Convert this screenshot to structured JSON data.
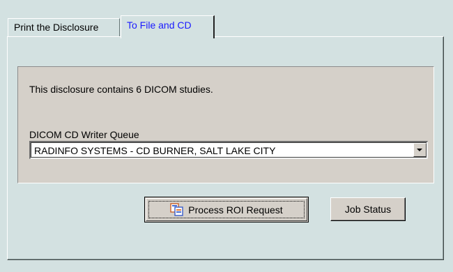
{
  "tabs": [
    {
      "label": "Print the Disclosure",
      "active": false
    },
    {
      "label": "To File and CD",
      "active": true
    }
  ],
  "panel": {
    "info_text": "This disclosure contains 6 DICOM studies.",
    "queue_label": "DICOM CD Writer Queue",
    "queue_selected": "RADINFO SYSTEMS - CD BURNER, SALT LAKE CITY"
  },
  "buttons": {
    "process_label": "Process ROI Request",
    "process_icon": "copy-documents-icon",
    "job_status_label": "Job Status"
  },
  "colors": {
    "window_bg": "#d3e1e1",
    "panel_bg": "#d5d0c9",
    "active_tab_text": "#1a1aff"
  }
}
